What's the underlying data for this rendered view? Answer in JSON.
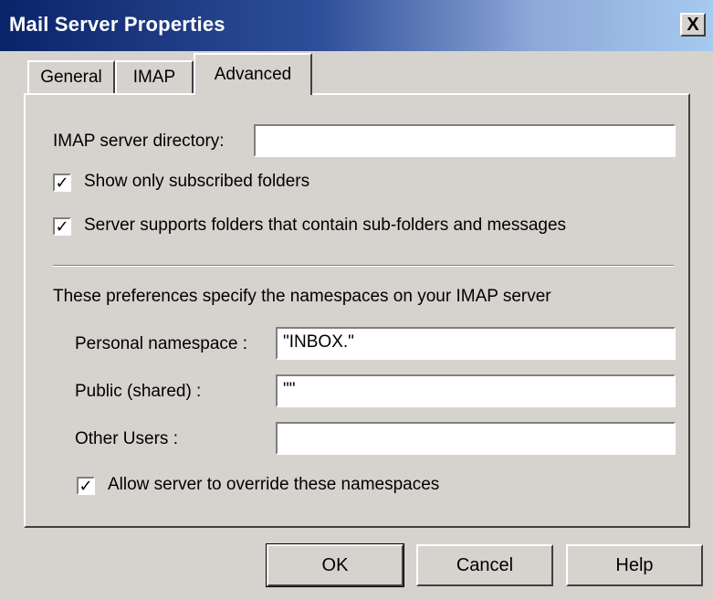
{
  "window": {
    "title": "Mail Server Properties",
    "close_glyph": "X"
  },
  "tabs": [
    {
      "label": "General"
    },
    {
      "label": "IMAP"
    },
    {
      "label": "Advanced",
      "selected": true
    }
  ],
  "advanced": {
    "imap_dir_label": "IMAP server directory:",
    "imap_dir_value": "",
    "show_subscribed_label": "Show only subscribed folders",
    "show_subscribed_checked": true,
    "supports_subfolders_label": "Server supports folders that contain sub-folders and messages",
    "supports_subfolders_checked": true,
    "namespace_intro": "These preferences specify the namespaces on your IMAP server",
    "personal_label": "Personal namespace :",
    "personal_value": "\"INBOX.\"",
    "public_label": "Public (shared) :",
    "public_value": "\"\"",
    "other_label": "Other Users :",
    "other_value": "",
    "allow_override_label": "Allow server to override these namespaces",
    "allow_override_checked": true,
    "check_glyph": "✓"
  },
  "buttons": {
    "ok": "OK",
    "cancel": "Cancel",
    "help": "Help"
  }
}
